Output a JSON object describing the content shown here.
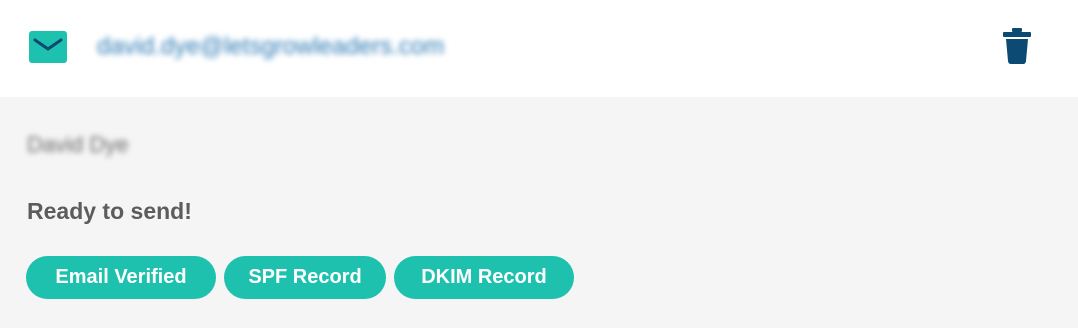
{
  "header": {
    "email": "david.dye@letsgrowleaders.com",
    "mail_icon": "mail-icon",
    "delete_icon": "trash-icon"
  },
  "details": {
    "sender_name": "David Dye",
    "status": "Ready to send!"
  },
  "badges": [
    {
      "label": "Email Verified"
    },
    {
      "label": "SPF Record"
    },
    {
      "label": "DKIM Record"
    }
  ],
  "colors": {
    "accent": "#1ec0ae",
    "link": "#2f7cb6",
    "trash": "#0d4a73",
    "header_bg": "#ffffff",
    "body_bg": "#f5f5f5"
  }
}
